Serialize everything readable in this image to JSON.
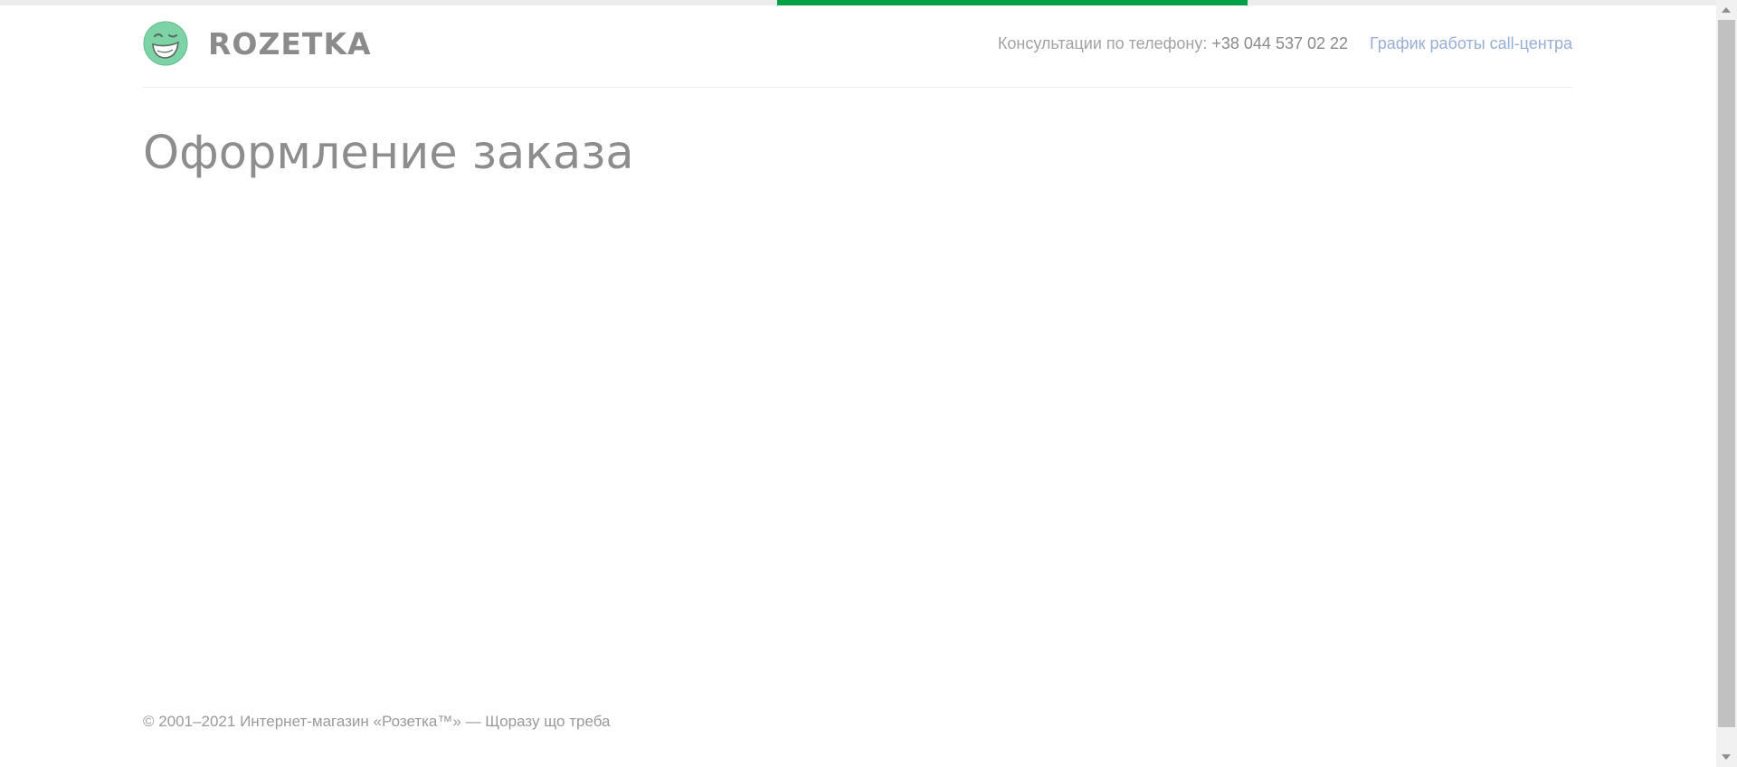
{
  "progress": {
    "start_fraction": 0.453,
    "end_fraction": 0.727,
    "color": "#00a046"
  },
  "header": {
    "logo_text": "ROZETKA",
    "logo_icon": "smiley-logo-icon",
    "phone_label": "Консультации по телефону:",
    "phone_number": "+38 044 537 02 22",
    "schedule_link": "График работы call-центра"
  },
  "main": {
    "title": "Оформление заказа"
  },
  "footer": {
    "copyright": "© 2001–2021 Интернет-магазин «Розетка™» — Щоразу що треба"
  },
  "colors": {
    "accent": "#00a046",
    "link": "#97aed6",
    "text_muted": "#8d8d8d",
    "logo_green": "#7dd3a6"
  }
}
